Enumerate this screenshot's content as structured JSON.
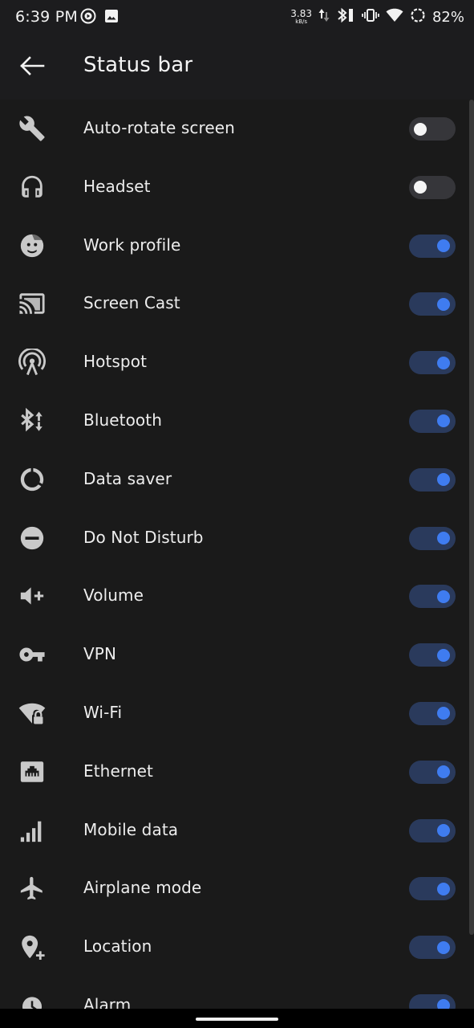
{
  "status_bar": {
    "time": "6:39 PM",
    "speed_value": "3.83",
    "speed_unit": "kB/s",
    "battery": "82%"
  },
  "app_bar": {
    "title": "Status bar",
    "back_icon": "arrow-back-icon"
  },
  "colors": {
    "background": "#1c1c1e",
    "toggle_on_track": "#2a3a5c",
    "toggle_on_knob": "#3f7cf0",
    "toggle_off_track": "#36363a",
    "toggle_off_knob": "#f5f5f5"
  },
  "settings": [
    {
      "label": "Auto-rotate screen",
      "icon": "wrench-icon",
      "enabled": false
    },
    {
      "label": "Headset",
      "icon": "headset-icon",
      "enabled": false
    },
    {
      "label": "Work profile",
      "icon": "work-profile-icon",
      "enabled": true
    },
    {
      "label": "Screen Cast",
      "icon": "screen-cast-icon",
      "enabled": true
    },
    {
      "label": "Hotspot",
      "icon": "hotspot-icon",
      "enabled": true
    },
    {
      "label": "Bluetooth",
      "icon": "bluetooth-icon",
      "enabled": true
    },
    {
      "label": "Data saver",
      "icon": "data-saver-icon",
      "enabled": true
    },
    {
      "label": "Do Not Disturb",
      "icon": "do-not-disturb-icon",
      "enabled": true
    },
    {
      "label": "Volume",
      "icon": "volume-icon",
      "enabled": true
    },
    {
      "label": "VPN",
      "icon": "vpn-key-icon",
      "enabled": true
    },
    {
      "label": "Wi-Fi",
      "icon": "wifi-lock-icon",
      "enabled": true
    },
    {
      "label": "Ethernet",
      "icon": "ethernet-icon",
      "enabled": true
    },
    {
      "label": "Mobile data",
      "icon": "signal-bars-icon",
      "enabled": true
    },
    {
      "label": "Airplane mode",
      "icon": "airplane-icon",
      "enabled": true
    },
    {
      "label": "Location",
      "icon": "location-add-icon",
      "enabled": true
    },
    {
      "label": "Alarm",
      "icon": "alarm-clock-icon",
      "enabled": true
    }
  ]
}
